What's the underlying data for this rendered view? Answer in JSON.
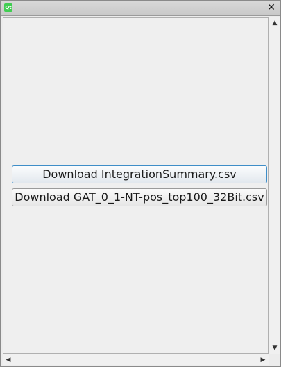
{
  "window": {
    "app_icon": "qt-logo-icon",
    "app_icon_text": "Qt",
    "close_glyph": "✕"
  },
  "main": {
    "buttons": [
      {
        "label": "Download IntegrationSummary.csv",
        "focused": true
      },
      {
        "label": "Download GAT_0_1-NT-pos_top100_32Bit.csv",
        "focused": false
      }
    ]
  },
  "scrollbars": {
    "up_arrow": "▲",
    "down_arrow": "▼",
    "left_arrow": "◀",
    "right_arrow": "▶"
  }
}
